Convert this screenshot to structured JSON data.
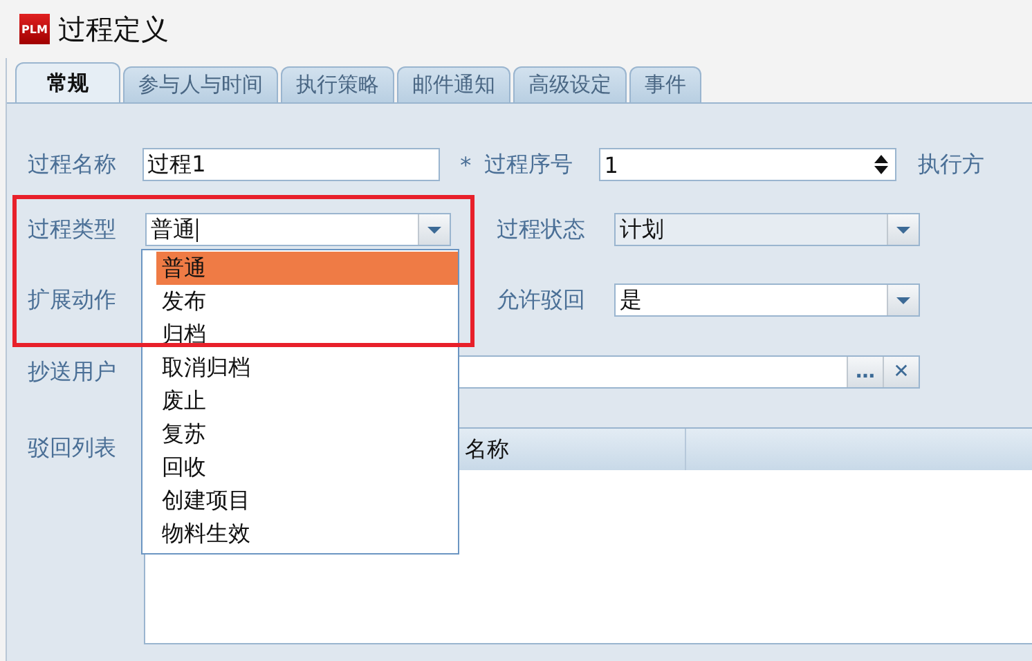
{
  "window": {
    "title": "过程定义",
    "logo": "PLM"
  },
  "tabs": [
    {
      "label": "常规",
      "selected": true
    },
    {
      "label": "参与人与时间",
      "selected": false
    },
    {
      "label": "执行策略",
      "selected": false
    },
    {
      "label": "邮件通知",
      "selected": false
    },
    {
      "label": "高级设定",
      "selected": false
    },
    {
      "label": "事件",
      "selected": false
    }
  ],
  "form": {
    "process_name": {
      "label": "过程名称",
      "value": "过程1"
    },
    "required_mark": "*",
    "process_number": {
      "label": "过程序号",
      "value": "1"
    },
    "execution_mode": {
      "label": "执行方"
    },
    "process_type": {
      "label": "过程类型",
      "value": "普通"
    },
    "process_status": {
      "label": "过程状态",
      "value": "计划"
    },
    "extended_action": {
      "label": "扩展动作"
    },
    "allow_reject": {
      "label": "允许驳回",
      "value": "是"
    },
    "cc_users": {
      "label": "抄送用户",
      "browse": "…",
      "clear": "✕"
    },
    "reject_list": {
      "label": "驳回列表"
    }
  },
  "table": {
    "columns": [
      "名称"
    ]
  },
  "dropdown": {
    "items": [
      {
        "label": "普通",
        "selected": true
      },
      {
        "label": "发布",
        "selected": false
      },
      {
        "label": "归档",
        "selected": false
      },
      {
        "label": "取消归档",
        "selected": false
      },
      {
        "label": "废止",
        "selected": false
      },
      {
        "label": "复苏",
        "selected": false
      },
      {
        "label": "回收",
        "selected": false
      },
      {
        "label": "创建项目",
        "selected": false
      },
      {
        "label": "物料生效",
        "selected": false
      }
    ]
  },
  "highlight": {
    "visible": true
  }
}
